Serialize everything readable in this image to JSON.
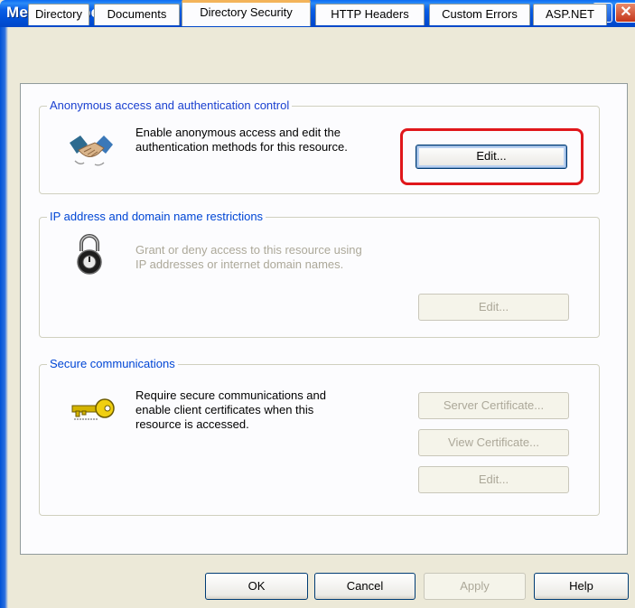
{
  "window": {
    "title": "Media Properties",
    "help_glyph": "?",
    "close_glyph": "✕"
  },
  "tabs": [
    {
      "label": "Directory",
      "active": false
    },
    {
      "label": "Documents",
      "active": false
    },
    {
      "label": "Directory Security",
      "active": true
    },
    {
      "label": "HTTP Headers",
      "active": false
    },
    {
      "label": "Custom Errors",
      "active": false
    },
    {
      "label": "ASP.NET",
      "active": false
    }
  ],
  "anonymous": {
    "title": "Anonymous access and authentication control",
    "description": "Enable anonymous access and edit the\nauthentication methods for this resource.",
    "edit_label": "Edit...",
    "icon": "handshake-icon"
  },
  "ip": {
    "title": "IP address and domain name restrictions",
    "description": "Grant or deny access to this resource using\nIP addresses or internet domain names.",
    "edit_label": "Edit...",
    "icon": "padlock-icon"
  },
  "secure": {
    "title": "Secure communications",
    "description": "Require secure communications and\nenable client certificates when this\nresource is accessed.",
    "server_cert_label": "Server Certificate...",
    "view_cert_label": "View Certificate...",
    "edit_label": "Edit...",
    "icon": "key-icon"
  },
  "footer": {
    "ok": "OK",
    "cancel": "Cancel",
    "apply": "Apply",
    "help": "Help"
  },
  "colors": {
    "group_title": "#0046d5",
    "highlight": "#e0171b",
    "titlebar": "#0050d8"
  }
}
